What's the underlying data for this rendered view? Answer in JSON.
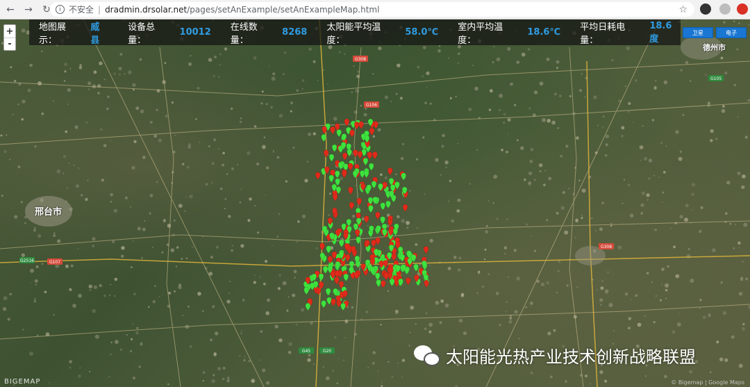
{
  "browser": {
    "insecure_label": "不安全",
    "url_host": "dradmin.drsolar.net",
    "url_path": "/pages/setAnExample/setAnExampleMap.html"
  },
  "stats": {
    "region_label": "地图展示：",
    "region_value": "威县",
    "devices_label": "设备总量：",
    "devices_value": "10012",
    "online_label": "在线数量：",
    "online_value": "8268",
    "solar_temp_label": "太阳能平均温度：",
    "solar_temp_value": "58.0℃",
    "indoor_temp_label": "室内平均温度：",
    "indoor_temp_value": "18.6℃",
    "power_label": "平均日耗电量：",
    "power_value": "18.6度"
  },
  "map_controls": {
    "zoom_in": "+",
    "zoom_out": "-",
    "type_buttons": [
      "卫星",
      "电子"
    ]
  },
  "map": {
    "city_label": "邢台市",
    "city_label_right": "德州市",
    "logo": "BIGEMAP",
    "copyright": "© Bigemap | Google Maps",
    "road_labels": [
      "G308",
      "G106",
      "G105",
      "G107",
      "G2516",
      "G45",
      "G20",
      "G308"
    ],
    "marker_colors": {
      "online": "#3ee23e",
      "offline": "#e02a1a"
    }
  },
  "watermark": {
    "text": "太阳能光热产业技术创新战略联盟"
  }
}
